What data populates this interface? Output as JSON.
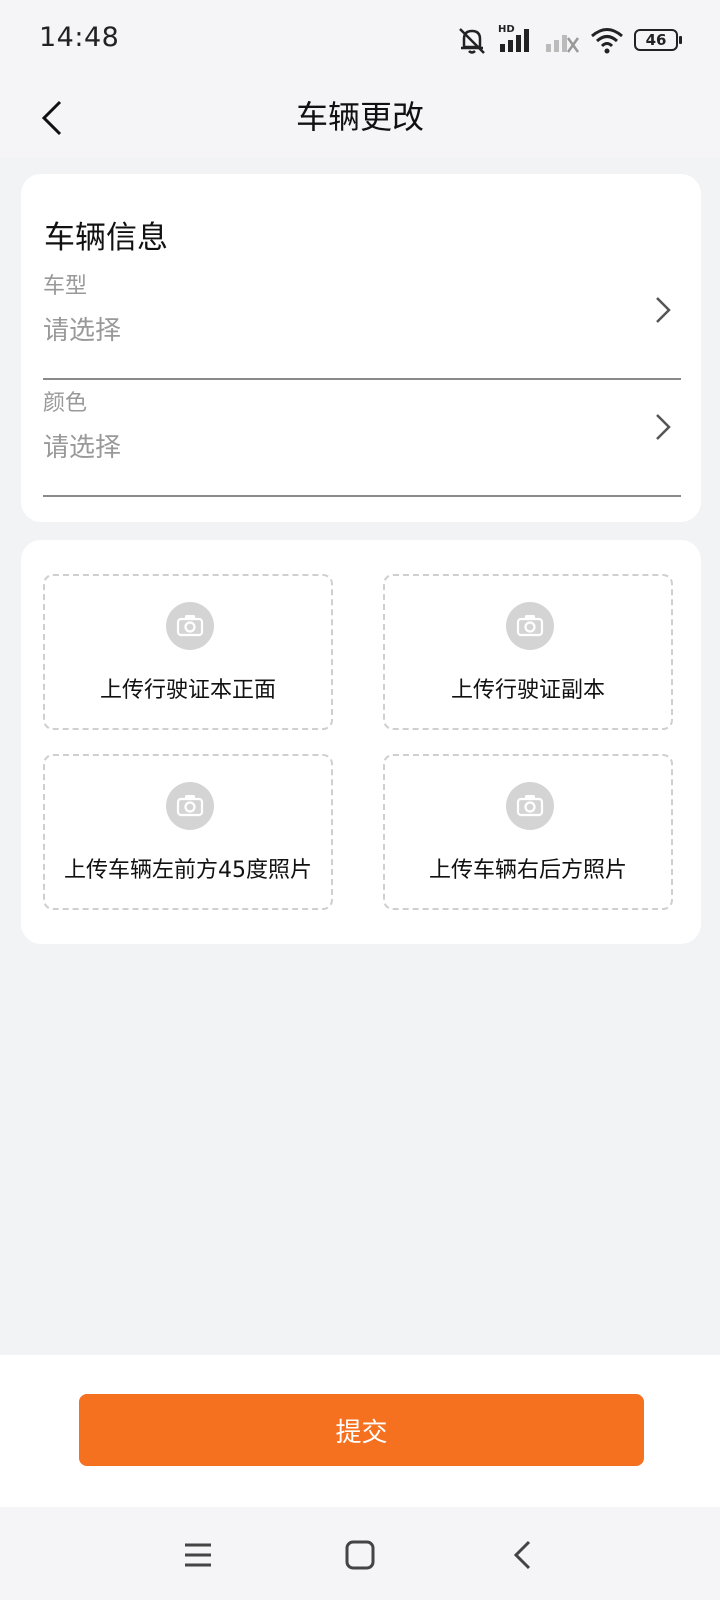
{
  "status_bar": {
    "time": "14:48",
    "network_label": "HD",
    "battery": "46",
    "icons": [
      "mute-bell-icon",
      "signal-hd-icon",
      "signal-no-sim-icon",
      "wifi-icon",
      "battery-icon"
    ]
  },
  "header": {
    "title": "车辆更改",
    "back_icon": "chevron-left-icon"
  },
  "vehicle_info": {
    "title": "车辆信息",
    "fields": [
      {
        "label": "车型",
        "value": "请选择",
        "icon": "chevron-right-icon"
      },
      {
        "label": "颜色",
        "value": "请选择",
        "icon": "chevron-right-icon"
      }
    ]
  },
  "uploads": [
    {
      "label": "上传行驶证本正面",
      "icon": "camera-icon"
    },
    {
      "label": "上传行驶证副本",
      "icon": "camera-icon"
    },
    {
      "label": "上传车辆左前方45度照片",
      "icon": "camera-icon"
    },
    {
      "label": "上传车辆右后方照片",
      "icon": "camera-icon"
    }
  ],
  "submit": {
    "label": "提交"
  },
  "nav_bar": {
    "icons": [
      "menu-icon",
      "home-square-icon",
      "back-triangle-icon"
    ]
  },
  "colors": {
    "accent": "#f5701f",
    "background": "#f2f3f5",
    "card": "#ffffff",
    "placeholder": "#999999"
  }
}
